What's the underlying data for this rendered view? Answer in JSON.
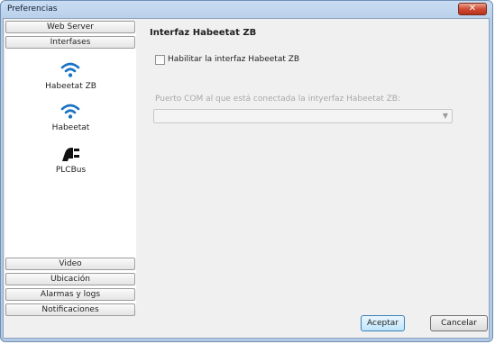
{
  "window": {
    "title": "Preferencias",
    "close_label": "✕"
  },
  "sidebar": {
    "top_sections": [
      {
        "label": "Web Server"
      },
      {
        "label": "Interfases"
      }
    ],
    "items": [
      {
        "label": "Habeetat ZB",
        "icon": "wifi-icon"
      },
      {
        "label": "Habeetat",
        "icon": "wifi-icon"
      },
      {
        "label": "PLCBus",
        "icon": "plug-icon"
      }
    ],
    "bottom_sections": [
      {
        "label": "Video"
      },
      {
        "label": "Ubicación"
      },
      {
        "label": "Alarmas y logs"
      },
      {
        "label": "Notificaciones"
      }
    ]
  },
  "panel": {
    "title": "Interfaz Habeetat ZB",
    "enable_label": "Habilitar la interfaz Habeetat ZB",
    "enable_checked": false,
    "com_label": "Puerto COM al que está conectada la intyerfaz Habeetat ZB:",
    "com_value": ""
  },
  "footer": {
    "accept_label": "Aceptar",
    "cancel_label": "Cancelar"
  },
  "colors": {
    "accent": "#1a73c5",
    "title_bar": "#c9dcf2"
  }
}
